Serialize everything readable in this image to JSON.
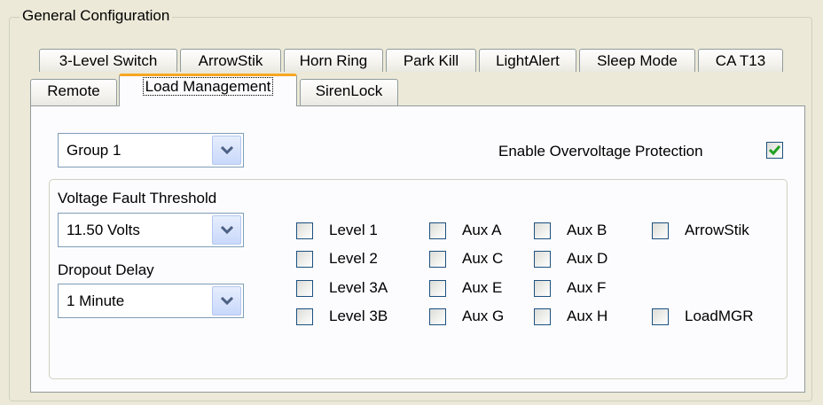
{
  "group_title": "General Configuration",
  "tabs_row1": [
    "3-Level Switch",
    "ArrowStik",
    "Horn Ring",
    "Park Kill",
    "LightAlert",
    "Sleep Mode",
    "CA T13"
  ],
  "tabs_row2": [
    "Remote",
    "Load Management",
    "SirenLock"
  ],
  "active_tab": "Load Management",
  "group_select": {
    "value": "Group 1"
  },
  "overvoltage": {
    "label": "Enable Overvoltage Protection",
    "checked": true
  },
  "voltage_threshold": {
    "label": "Voltage Fault Threshold",
    "value": "11.50 Volts"
  },
  "dropout_delay": {
    "label": "Dropout Delay",
    "value": "1 Minute"
  },
  "checkboxes": [
    {
      "label": "Level 1",
      "checked": false
    },
    {
      "label": "Aux A",
      "checked": false
    },
    {
      "label": "Aux B",
      "checked": false
    },
    {
      "label": "ArrowStik",
      "checked": false
    },
    {
      "label": "Level 2",
      "checked": false
    },
    {
      "label": "Aux C",
      "checked": false
    },
    {
      "label": "Aux D",
      "checked": false
    },
    {
      "label": "Level 3A",
      "checked": false
    },
    {
      "label": "Aux E",
      "checked": false
    },
    {
      "label": "Aux F",
      "checked": false
    },
    {
      "label": "Level 3B",
      "checked": false
    },
    {
      "label": "Aux G",
      "checked": false
    },
    {
      "label": "Aux H",
      "checked": false
    },
    {
      "label": "LoadMGR",
      "checked": false
    }
  ],
  "colors": {
    "accent_tab": "#f6a623",
    "check_green": "#21a121",
    "combo_arrow": "#4d6185"
  }
}
